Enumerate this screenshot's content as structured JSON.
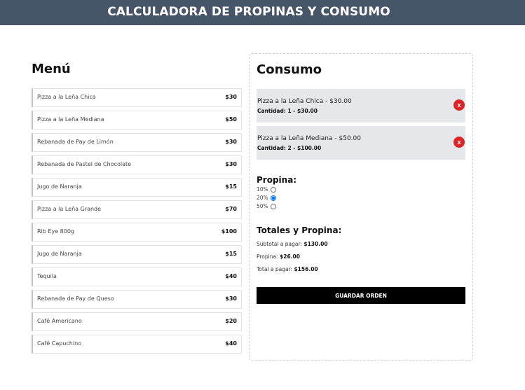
{
  "header": {
    "title": "CALCULADORA DE PROPINAS Y CONSUMO"
  },
  "menu": {
    "title": "Menú",
    "items": [
      {
        "name": "Pizza a la Leña Chica",
        "price": "$30"
      },
      {
        "name": "Pizza a la Leña Mediana",
        "price": "$50"
      },
      {
        "name": "Rebanada de Pay de Limón",
        "price": "$30"
      },
      {
        "name": "Rebanada de Pastel de Chocolate",
        "price": "$30"
      },
      {
        "name": "Jugo de Naranja",
        "price": "$15"
      },
      {
        "name": "Pizza a la Leña Grande",
        "price": "$70"
      },
      {
        "name": "Rib Eye 800g",
        "price": "$100"
      },
      {
        "name": "Jugo de Naranja",
        "price": "$15"
      },
      {
        "name": "Tequila",
        "price": "$40"
      },
      {
        "name": "Rebanada de Pay de Queso",
        "price": "$30"
      },
      {
        "name": "Café Americano",
        "price": "$20"
      },
      {
        "name": "Café Capuchino",
        "price": "$40"
      }
    ]
  },
  "consumo": {
    "title": "Consumo",
    "orders": [
      {
        "title": "Pizza a la Leña Chica - $30.00",
        "qty": "Cantidad: 1 - $30.00",
        "remove": "x"
      },
      {
        "title": "Pizza a la Leña Mediana - $50.00",
        "qty": "Cantidad: 2 - $100.00",
        "remove": "x"
      }
    ],
    "tip_title": "Propina:",
    "tip_options": [
      {
        "label": "10%",
        "checked": false
      },
      {
        "label": "20%",
        "checked": true
      },
      {
        "label": "50%",
        "checked": false
      }
    ],
    "totals_title": "Totales y Propina:",
    "subtotal_label": "Subtotal a pagar:",
    "subtotal_value": "$130.00",
    "tip_label": "Propina:",
    "tip_value": "$26.00",
    "total_label": "Total a pagar:",
    "total_value": "$156.00",
    "save_label": "GUARDAR ORDEN"
  },
  "colors": {
    "header_bg": "#475569",
    "order_bg": "#e5e7eb",
    "remove_bg": "#dc2626",
    "save_bg": "#000000"
  }
}
